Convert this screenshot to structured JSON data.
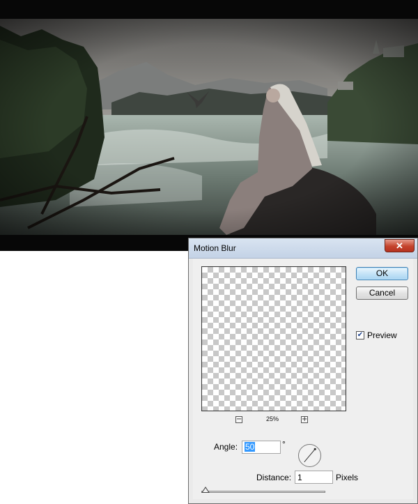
{
  "dialog": {
    "title": "Motion Blur",
    "close_label": "✕",
    "ok_label": "OK",
    "cancel_label": "Cancel",
    "preview_label": "Preview",
    "preview_checked": true,
    "zoom_out_symbol": "−",
    "zoom_in_symbol": "+",
    "zoom_level": "25%",
    "angle_label": "Angle:",
    "angle_value": "50",
    "angle_unit": "°",
    "distance_label": "Distance:",
    "distance_value": "1",
    "distance_unit": "Pixels",
    "distance_slider_fraction": 0.0
  },
  "icons": {
    "close": "close-icon",
    "checkmark": "checkmark-icon",
    "angle_dial": "angle-dial-icon"
  },
  "colors": {
    "title_bar": "#c3d2e6",
    "close_button": "#c4432c",
    "selection": "#3399ff",
    "default_button_border": "#3c7fb1"
  }
}
